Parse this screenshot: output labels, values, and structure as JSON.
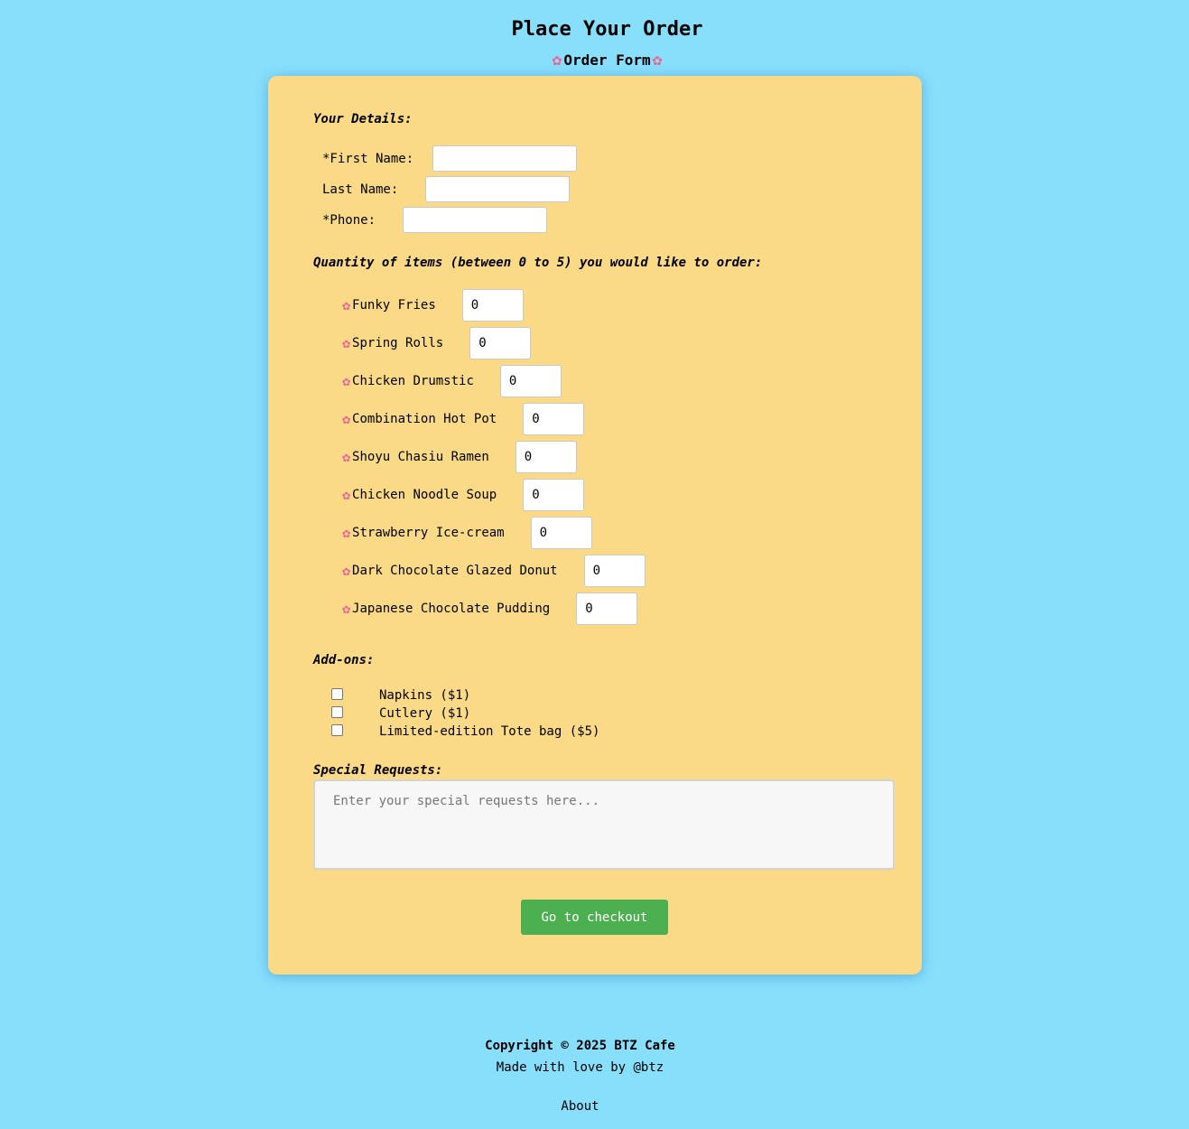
{
  "header": {
    "title": "Place Your Order",
    "subtitle": "Order Form",
    "subtitle_icon": "sakura-flower-icon"
  },
  "details": {
    "heading": "Your Details:",
    "first_name_label": "*First Name:",
    "first_name_value": "",
    "last_name_label": "Last Name:",
    "last_name_value": "",
    "phone_label": "*Phone:",
    "phone_value": ""
  },
  "quantity": {
    "heading": "Quantity of items (between 0 to 5) you would like to order:",
    "items": [
      {
        "name": "Funky Fries",
        "qty": "0"
      },
      {
        "name": "Spring Rolls",
        "qty": "0"
      },
      {
        "name": "Chicken Drumstic",
        "qty": "0"
      },
      {
        "name": "Combination Hot Pot",
        "qty": "0"
      },
      {
        "name": "Shoyu Chasiu Ramen",
        "qty": "0"
      },
      {
        "name": "Chicken Noodle Soup",
        "qty": "0"
      },
      {
        "name": "Strawberry Ice-cream",
        "qty": "0"
      },
      {
        "name": "Dark Chocolate Glazed Donut",
        "qty": "0"
      },
      {
        "name": "Japanese Chocolate Pudding",
        "qty": "0"
      }
    ]
  },
  "addons": {
    "heading": "Add-ons:",
    "items": [
      {
        "label": "Napkins ($1)",
        "checked": false
      },
      {
        "label": "Cutlery ($1)",
        "checked": false
      },
      {
        "label": "Limited-edition Tote bag ($5)",
        "checked": false
      }
    ]
  },
  "special": {
    "heading": "Special Requests:",
    "placeholder": "Enter your special requests here...",
    "value": ""
  },
  "checkout_button": "Go to checkout",
  "footer": {
    "copyright": "Copyright © 2025 BTZ Cafe",
    "credit": "Made with love by @btz",
    "about_link": "About"
  },
  "colors": {
    "background": "#87dffc",
    "card": "#fad987",
    "button": "#4caf50",
    "flower": "#f06292"
  }
}
